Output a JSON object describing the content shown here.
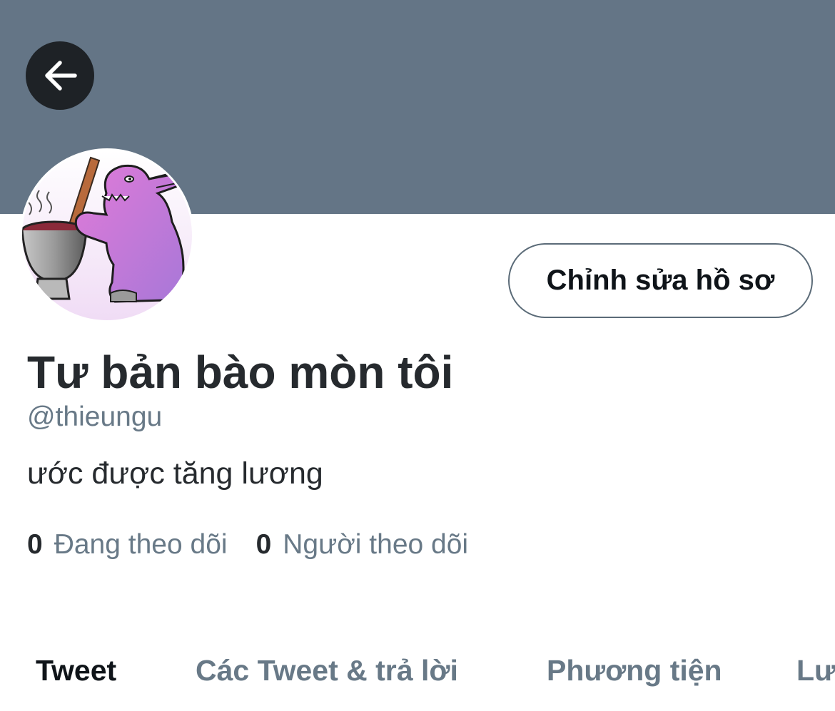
{
  "colors": {
    "banner": "#647586",
    "back_button_bg": "#1e2226",
    "text_primary": "#262a2e",
    "text_secondary": "#687987"
  },
  "header": {
    "back_icon": "arrow-left-icon"
  },
  "profile": {
    "avatar_description_icon": "avatar",
    "edit_button_label": "Chỉnh sửa hồ sơ",
    "display_name": "Tư bản bào mòn tôi",
    "handle": "@thieungu",
    "bio": "ước được tăng lương",
    "following_count": "0",
    "following_label": "Đang theo dõi",
    "followers_count": "0",
    "followers_label": "Người theo dõi"
  },
  "tabs": [
    {
      "label": "Tweet",
      "active": true
    },
    {
      "label": "Các Tweet & trả lời",
      "active": false
    },
    {
      "label": "Phương tiện",
      "active": false
    },
    {
      "label": "Lượt thích",
      "active": false
    }
  ]
}
